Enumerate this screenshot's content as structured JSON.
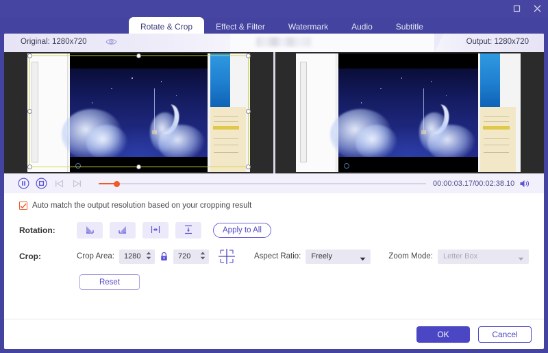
{
  "window": {
    "maximize_icon": "maximize-icon",
    "close_icon": "close-icon"
  },
  "tabs": [
    {
      "label": "Rotate & Crop",
      "active": true
    },
    {
      "label": "Effect & Filter",
      "active": false
    },
    {
      "label": "Watermark",
      "active": false
    },
    {
      "label": "Audio",
      "active": false
    },
    {
      "label": "Subtitle",
      "active": false
    }
  ],
  "preview_header": {
    "original_label": "Original: 1280x720",
    "output_label": "Output: 1280x720",
    "eye_icon": "eye-icon",
    "center_title_blurred": ""
  },
  "playback": {
    "pause_icon": "pause-icon",
    "stop_icon": "stop-icon",
    "prev_frame_icon": "previous-frame-icon",
    "next_frame_icon": "next-frame-icon",
    "timecode": "00:00:03.17/00:02:38.10",
    "volume_icon": "volume-icon",
    "progress_percent": 2
  },
  "auto_match": {
    "checked": true,
    "label": "Auto match the output resolution based on your cropping result"
  },
  "rotation": {
    "label": "Rotation:",
    "buttons": [
      {
        "name": "rotate-left-button",
        "icon": "rotate-left-icon"
      },
      {
        "name": "rotate-right-button",
        "icon": "rotate-right-icon"
      },
      {
        "name": "flip-horizontal-button",
        "icon": "flip-horizontal-icon"
      },
      {
        "name": "flip-vertical-button",
        "icon": "flip-vertical-icon"
      }
    ],
    "apply_to_all_label": "Apply to All"
  },
  "crop": {
    "label": "Crop:",
    "crop_area_label": "Crop Area:",
    "width_value": "1280",
    "height_value": "720",
    "lock_icon": "lock-icon",
    "lock_state": "locked",
    "crop_position_icon": "crop-position-icon",
    "aspect_ratio_label": "Aspect Ratio:",
    "aspect_ratio_value": "Freely",
    "zoom_mode_label": "Zoom Mode:",
    "zoom_mode_value": "Letter Box",
    "zoom_mode_disabled": true,
    "reset_label": "Reset"
  },
  "footer": {
    "ok_label": "OK",
    "cancel_label": "Cancel"
  },
  "colors": {
    "brand_purple": "#4a46c4",
    "titlebar": "#4645a1",
    "accent_orange": "#f05a28",
    "crop_outline": "#d5d53b",
    "panel_bg": "#ffffff",
    "field_bg": "#e9e8f2"
  }
}
